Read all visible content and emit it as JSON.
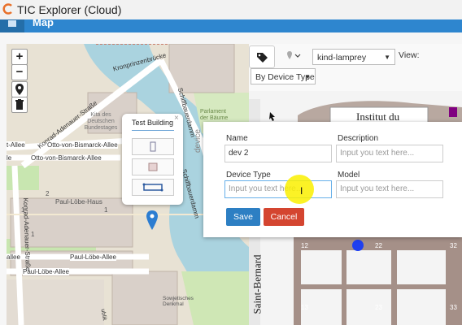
{
  "app": {
    "title": "TIC Explorer (Cloud)",
    "section": "Map"
  },
  "map": {
    "streets": [
      "Kronprinzenbrücke",
      "Konrad-Adenauer-Straße",
      "Otto-von-Bismarck-Allee",
      "Otto-von-Bismarck-Allee",
      "Paul-Löbe-Allee",
      "Paul-Löbe-Allee",
      "Schiffbauerdamm",
      "Schiffbauerdamm",
      "Konrad-Adenauer-Straße"
    ],
    "places": [
      "Kita des Deutschen Bundestages",
      "Paul-Löbe-Haus",
      "Parlament der Bäume",
      "Sowjetisches Denkmal"
    ],
    "partial_labels": [
      "t-Allee",
      "le",
      "allee",
      "ublik"
    ],
    "house_numbers": [
      "1",
      "2",
      "1",
      "1"
    ],
    "zoom_in": "+",
    "zoom_out": "−",
    "popup": {
      "title": "Test Building",
      "close": "×"
    }
  },
  "toolbar": {
    "device_select": "kind-lamprey",
    "view_label": "View:",
    "view_mode": "By Device Type"
  },
  "floorplan": {
    "building_label": "Institut du",
    "street_label": "Saint-Bernard",
    "rooms": [
      "12",
      "22",
      "32",
      "13",
      "23",
      "33"
    ]
  },
  "form": {
    "section": "device",
    "name_label": "Name",
    "name_value": "dev 2",
    "description_label": "Description",
    "description_placeholder": "Input you text here...",
    "device_type_label": "Device Type",
    "device_type_placeholder": "Input you text here...",
    "model_label": "Model",
    "model_placeholder": "Input you text here...",
    "save_label": "Save",
    "cancel_label": "Cancel"
  },
  "colors": {
    "navbar": "#2e86cf",
    "save": "#2d7fc3",
    "cancel": "#d44530",
    "highlight": "#f5ec00"
  }
}
